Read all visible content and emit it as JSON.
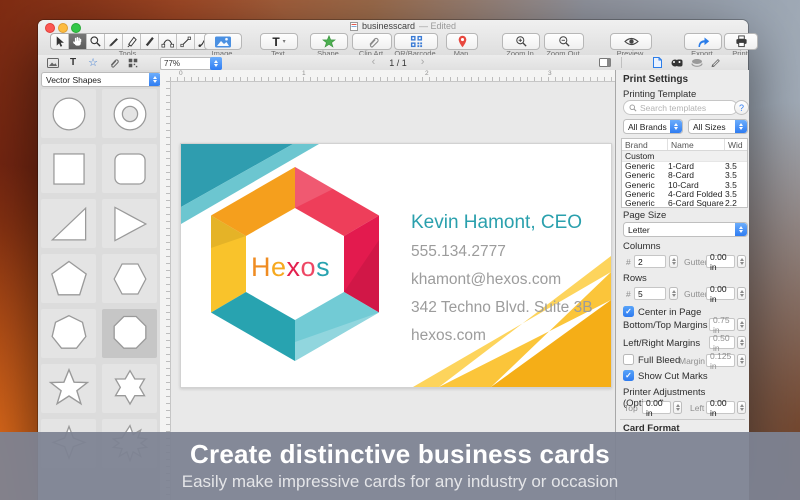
{
  "window": {
    "title": "businesscard",
    "title_suffix": "— Edited",
    "tools_group_label": "Tools",
    "toolbar_buttons": [
      {
        "label": "Image"
      },
      {
        "label": "Text"
      },
      {
        "label": "Shape"
      },
      {
        "label": "Clip Art"
      },
      {
        "label": "QR/Barcode"
      },
      {
        "label": "Map"
      },
      {
        "label": "Zoom In"
      },
      {
        "label": "Zoom Out"
      },
      {
        "label": "Preview"
      },
      {
        "label": "Export"
      },
      {
        "label": "Print"
      }
    ],
    "zoom_level": "77%",
    "page_indicator": "1 / 1",
    "nav_prev": "‹",
    "nav_next": "›"
  },
  "sidebar": {
    "library_dropdown": "Vector Shapes",
    "shapes": [
      "circle",
      "donut",
      "square",
      "rounded-square",
      "right-triangle",
      "triangle",
      "pentagon",
      "hexagon",
      "heptagon",
      "octagon",
      "star-5",
      "star-6",
      "star-4",
      "star-8"
    ],
    "selected_shape": "octagon"
  },
  "canvas": {
    "ruler_numbers": [
      "0",
      "1",
      "2",
      "3"
    ]
  },
  "card": {
    "logo_letters": [
      "H",
      "e",
      "x",
      "o",
      "s"
    ],
    "name": "Kevin Hamont, CEO",
    "phone": "555.134.2777",
    "email": "khamont@hexos.com",
    "address": "342 Techno Blvd. Suite 3B",
    "website": "hexos.com"
  },
  "print_settings": {
    "title": "Print Settings",
    "template_label": "Printing Template",
    "search_placeholder": "Search templates",
    "help_label": "?",
    "brands_dropdown": "All Brands",
    "sizes_dropdown": "All Sizes",
    "table": {
      "headers": [
        "Brand",
        "Name",
        "Wid"
      ],
      "group_row": "Custom",
      "rows": [
        [
          "Generic",
          "1-Card",
          "3.5"
        ],
        [
          "Generic",
          "8-Card",
          "3.5"
        ],
        [
          "Generic",
          "10-Card",
          "3.5"
        ],
        [
          "Generic",
          "4-Card Folded",
          "3.5"
        ],
        [
          "Generic",
          "6-Card Square",
          "2.2"
        ]
      ]
    },
    "page_size_label": "Page Size",
    "page_size_value": "Letter",
    "columns_label": "Columns",
    "number_sign": "#",
    "columns_value": "2",
    "gutter_label": "Gutter",
    "columns_gutter_value": "0.00 in",
    "rows_label": "Rows",
    "rows_value": "5",
    "rows_gutter_value": "0.00 in",
    "center_in_page_label": "Center in Page",
    "center_in_page_checked": true,
    "bottom_top_margins_label": "Bottom/Top Margins",
    "bottom_top_margins_value": "0.75 in",
    "left_right_margins_label": "Left/Right Margins",
    "left_right_margins_value": "0.50 in",
    "full_bleed_label": "Full Bleed",
    "full_bleed_checked": false,
    "margin_label": "Margin",
    "full_bleed_margin_value": "0.125 in",
    "show_cut_marks_label": "Show Cut Marks",
    "show_cut_marks_checked": true,
    "printer_adjustments_label": "Printer Adjustments (Optional)",
    "top_label": "Top",
    "top_value": "0.00 in",
    "left_label": "Left",
    "left_value": "0.00 in",
    "card_format_label": "Card Format",
    "checkmark": "✓"
  },
  "banner": {
    "title": "Create distinctive business cards",
    "subtitle": "Easily make impressive cards for any industry or occasion"
  },
  "colors": {
    "accent_blue": "#2f7cf2",
    "logo_orange": "#f59f1d",
    "logo_yellow": "#f9c32b",
    "logo_red": "#ee3e5a",
    "logo_crimson": "#e31a4e",
    "logo_teal": "#28a3b0",
    "logo_teal_light": "#72cbd5",
    "card_name_teal": "#2aa0ad",
    "banner_bg": "#7d8393"
  }
}
